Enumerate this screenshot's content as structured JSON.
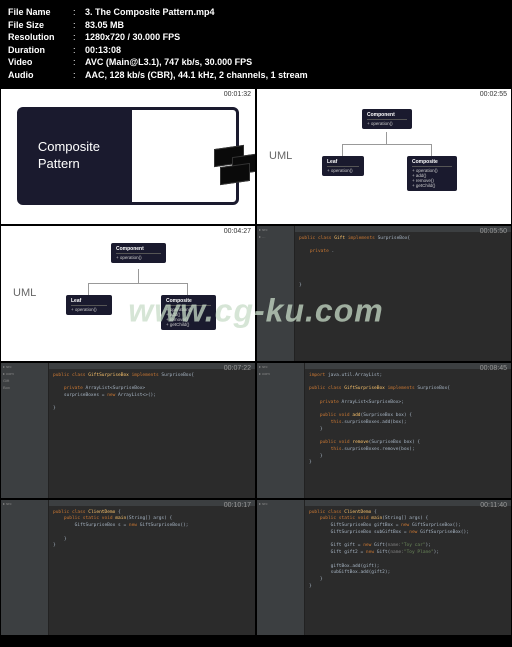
{
  "header": {
    "rows": [
      {
        "label": "File Name",
        "value": "3. The Composite Pattern.mp4"
      },
      {
        "label": "File Size",
        "value": "83.05 MB"
      },
      {
        "label": "Resolution",
        "value": "1280x720 / 30.000 FPS"
      },
      {
        "label": "Duration",
        "value": "00:13:08"
      },
      {
        "label": "Video",
        "value": "AVC (Main@L3.1), 747 kb/s, 30.000 FPS"
      },
      {
        "label": "Audio",
        "value": "AAC, 128 kb/s (CBR), 44.1 kHz, 2 channels, 1 stream"
      }
    ]
  },
  "watermark": "www.cg-ku.com",
  "thumbnails": {
    "t1": {
      "time": "00:01:32",
      "title": "Composite\nPattern"
    },
    "t2": {
      "time": "00:02:55",
      "label": "UML",
      "component": "Component",
      "leaf": "Leaf",
      "composite": "Composite",
      "op": "+ operation()",
      "add": "+ add()",
      "remove": "+ remove()",
      "getchild": "+ getChild()"
    },
    "t3": {
      "time": "00:04:27",
      "label": "UML",
      "component": "Component",
      "leaf": "Leaf",
      "composite": "Composite",
      "op": "+ operation()",
      "add": "+ add()",
      "remove": "+ remove()",
      "getchild": "+ getChild()"
    },
    "t4": {
      "time": "00:05:50",
      "code": "public class Gift implements SurpriseBox{\n\n    private .\n\n\n\n\n\n}"
    },
    "t5": {
      "time": "00:07:22",
      "code": "public class GiftSurpriseBox implements SurpriseBox{\n\n    private ArrayList<SurpriseBox>\n    surpriseBoxes = new ArrayList<>();\n\n}"
    },
    "t6": {
      "time": "00:08:45",
      "code": "import java.util.ArrayList;\n\npublic class GiftSurpriseBox implements SurpriseBox{\n\n    private ArrayList<SurpriseBox>;\n\n    public void add(SurpriseBox box) {\n        this.surpriseBoxes.add(box);\n    }\n\n    public void remove(SurpriseBox box) {\n        this.surpriseBoxes.remove(box);\n    }\n}"
    },
    "t7": {
      "time": "00:10:17",
      "code": "public class ClientDemo {\n    public static void main(String[] args) {\n        GiftSurpriseBox s = new GiftSurpriseBox();\n\n    }\n}"
    },
    "t8": {
      "time": "00:11:40",
      "code": "public class ClientDemo {\n    public static void main(String[] args) {\n        GiftSurpriseBox giftBox = new GiftSurpriseBox();\n        GiftSurpriseBox subGiftBox = new GiftSurpriseBox();\n\n        Gift gift = new Gift(name:\"Toy car\");\n        Gift gift2 = new Gift(name:\"Toy Plane\");\n\n        giftBox.add(gift);\n        subGiftBox.add(gift2);\n    }\n}"
    }
  }
}
